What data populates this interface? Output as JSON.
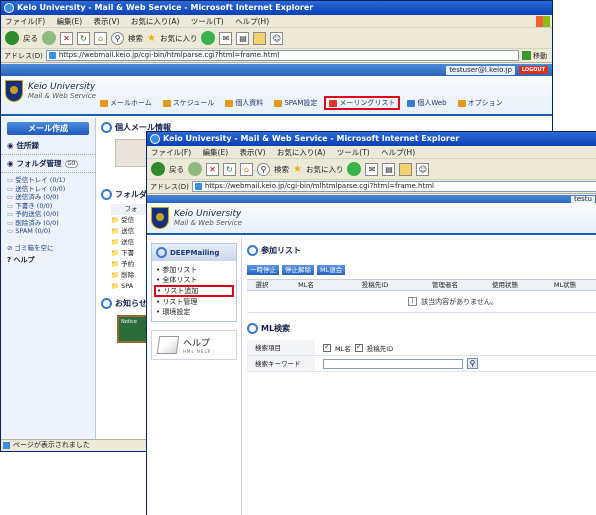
{
  "back_window": {
    "title": "Keio University - Mail & Web Service - Microsoft Internet Explorer",
    "menu": [
      "ファイル(F)",
      "編集(E)",
      "表示(V)",
      "お気に入り(A)",
      "ツール(T)",
      "ヘルプ(H)"
    ],
    "toolbar": {
      "back": "戻る",
      "search": "検索",
      "favorites": "お気に入り"
    },
    "address_label": "アドレス(D)",
    "address": "https://webmail.keio.jp/cgi-bin/htmlparse.cgi?html=frame.html",
    "go": "移動",
    "user": "testuser@l.keio.jp",
    "logout": "LOGOUT",
    "logo": {
      "line1": "Keio University",
      "line2": "Mail & Web Service"
    },
    "nav": [
      {
        "label": "メールホーム"
      },
      {
        "label": "スケジュール"
      },
      {
        "label": "個人資料"
      },
      {
        "label": "SPAM設定"
      },
      {
        "label": "メーリングリスト"
      },
      {
        "label": "個人Web"
      },
      {
        "label": "オプション"
      }
    ],
    "compose": "メール作成",
    "address_book": "住所録",
    "folder_manage": "フォルダ管理",
    "folder_manage_badge": "GO",
    "folders": [
      "受信トレイ (0/1)",
      "送信トレイ (0/0)",
      "送信済み (0/0)",
      "下書き (0/0)",
      "予約送信 (0/0)",
      "削除済み (0/0)",
      "SPAM (0/0)"
    ],
    "empty_trash": "ゴミ箱を空に",
    "help": "ヘルプ",
    "personal_info": "個人メール情報",
    "folder_section": "フォルダ",
    "folder_table_head": "フォ",
    "folder_rows": [
      "受信",
      "送信",
      "送信",
      "下書",
      "予約",
      "削除",
      "SPA"
    ],
    "notice_section": "お知らせ",
    "notice_label": "Notice",
    "status": "ページが表示されました"
  },
  "front_window": {
    "title": "Keio University - Mail & Web Service - Microsoft Internet Explorer",
    "menu": [
      "ファイル(F)",
      "編集(E)",
      "表示(V)",
      "お気に入り(A)",
      "ツール(T)",
      "ヘルプ(H)"
    ],
    "toolbar": {
      "back": "戻る",
      "search": "検索",
      "favorites": "お気に入り"
    },
    "address_label": "アドレス(D)",
    "address": "https://webmail.keio.jp/cgi-bin/mlhtmlparse.cgi?html=frame.html",
    "user": "testu",
    "logo": {
      "line1": "Keio University",
      "line2": "Mail & Web Service"
    },
    "deep_title": "DEEPMailing",
    "deep_items": [
      "参加リスト",
      "全体リスト",
      "リスト追加",
      "リスト管理",
      "環境設定"
    ],
    "help_title": "ヘルプ",
    "help_sub": "HML HELP",
    "section_lists": "参加リスト",
    "buttons": [
      "一時停止",
      "停止解除",
      "ML退会"
    ],
    "table_headers": [
      "選択",
      "ML名",
      "投稿先ID",
      "管理者名",
      "使用状態",
      "ML状態"
    ],
    "empty_message": "該当内容がありません。",
    "section_search": "ML検索",
    "search_item_label": "検索項目",
    "search_options": [
      "ML名",
      "投稿先ID"
    ],
    "search_keyword_label": "検索キーワード"
  },
  "colors": {
    "accent": "#1b5bb0",
    "highlight": "#e0001b",
    "titlebar": "#0a3fb4"
  }
}
